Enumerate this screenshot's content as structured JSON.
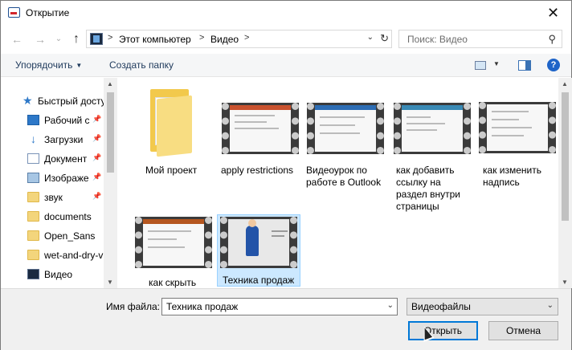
{
  "window": {
    "title": "Открытие",
    "close_label": "✕"
  },
  "address": {
    "crumbs": [
      "Этот компьютер",
      "Видео"
    ],
    "separators": [
      ">",
      ">",
      ">"
    ],
    "dropdown_glyph": "⌄",
    "refresh_glyph": "↻"
  },
  "search": {
    "placeholder": "Поиск: Видео"
  },
  "toolbar": {
    "organize_label": "Упорядочить",
    "new_folder_label": "Создать папку",
    "help_label": "?"
  },
  "nav": {
    "back": "←",
    "forward": "→",
    "history": "⌄",
    "up": "↑",
    "items": [
      {
        "label": "Быстрый досту",
        "icon": "star-icon"
      },
      {
        "label": "Рабочий с",
        "icon": "desktop-icon",
        "pinned": true
      },
      {
        "label": "Загрузки",
        "icon": "download-icon",
        "pinned": true
      },
      {
        "label": "Документ",
        "icon": "document-icon",
        "pinned": true
      },
      {
        "label": "Изображе",
        "icon": "pictures-icon",
        "pinned": true
      },
      {
        "label": "звук",
        "icon": "folder-icon",
        "pinned": true
      },
      {
        "label": "documents",
        "icon": "folder-icon"
      },
      {
        "label": "Open_Sans",
        "icon": "folder-icon"
      },
      {
        "label": "wet-and-dry-v",
        "icon": "folder-icon"
      },
      {
        "label": "Видео",
        "icon": "video-folder-icon"
      }
    ]
  },
  "files": [
    {
      "name": "Мой проект",
      "type": "folder"
    },
    {
      "name": "apply restrictions",
      "type": "video"
    },
    {
      "name": "Видеоурок по работе в Outlook",
      "type": "video"
    },
    {
      "name": "как добавить ссылку на раздел внутри страницы",
      "type": "video"
    },
    {
      "name": "как изменить надпись",
      "type": "video"
    },
    {
      "name": "как скрыть",
      "type": "video"
    },
    {
      "name": "Техника продаж",
      "type": "video",
      "selected": true
    }
  ],
  "footer": {
    "filename_label": "Имя файла:",
    "filename_value": "Техника продаж",
    "filetype_value": "Видеофайлы",
    "open_label": "Открыть",
    "cancel_label": "Отмена"
  },
  "colors": {
    "accent": "#0078d7",
    "selection": "#cce8ff"
  }
}
